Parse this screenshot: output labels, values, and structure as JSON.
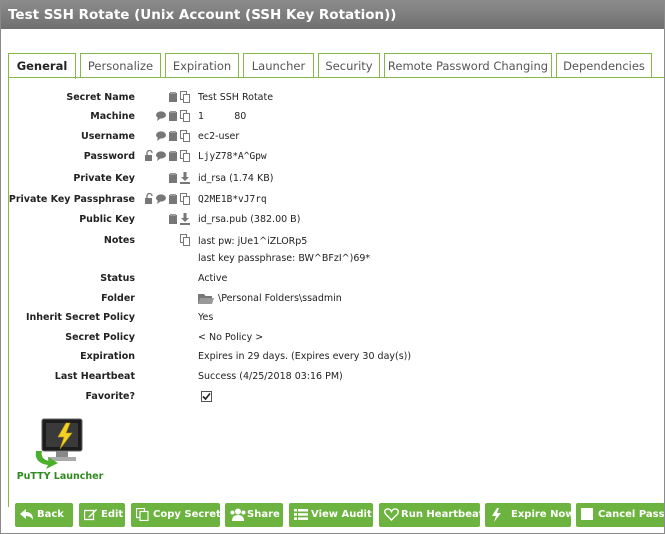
{
  "window": {
    "title": "Test SSH Rotate (Unix Account (SSH Key Rotation))"
  },
  "tabs": [
    {
      "label": "General",
      "active": true
    },
    {
      "label": "Personalize",
      "active": false
    },
    {
      "label": "Expiration",
      "active": false
    },
    {
      "label": "Launcher",
      "active": false
    },
    {
      "label": "Security",
      "active": false
    },
    {
      "label": "Remote Password Changing",
      "active": false
    },
    {
      "label": "Dependencies",
      "active": false
    }
  ],
  "fields": {
    "secret_name": {
      "label": "Secret Name",
      "value": "Test SSH Rotate"
    },
    "machine": {
      "label": "Machine",
      "value": "1          80"
    },
    "username": {
      "label": "Username",
      "value": "ec2-user"
    },
    "password": {
      "label": "Password",
      "value": "LjyZ78*A^Gpw"
    },
    "private_key": {
      "label": "Private Key",
      "value": "id_rsa (1.74 KB)"
    },
    "private_key_passphrase": {
      "label": "Private Key Passphrase",
      "value": "Q2ME1B*vJ7rq"
    },
    "public_key": {
      "label": "Public Key",
      "value": "id_rsa.pub (382.00 B)"
    },
    "notes": {
      "label": "Notes",
      "line1": "last pw: jUe1^iZLORp5",
      "line2": "last key passphrase: BW^BFzI^)69*"
    },
    "status": {
      "label": "Status",
      "value": "Active"
    },
    "folder": {
      "label": "Folder",
      "value": "\\Personal Folders\\ssadmin"
    },
    "inherit_secret_policy": {
      "label": "Inherit Secret Policy",
      "value": "Yes"
    },
    "secret_policy": {
      "label": "Secret Policy",
      "value": "< No Policy >"
    },
    "expiration": {
      "label": "Expiration",
      "value": "Expires in 29 days. (Expires every 30 day(s))"
    },
    "last_heartbeat": {
      "label": "Last Heartbeat",
      "value": "Success (4/25/2018 03:16 PM)"
    },
    "favorite": {
      "label": "Favorite?",
      "checked": true
    }
  },
  "launcher": {
    "label": "PuTTY Launcher"
  },
  "buttons": {
    "back": "Back",
    "edit": "Edit",
    "copy_secret": "Copy Secret",
    "share": "Share",
    "view_audit": "View Audit",
    "run_heartbeat": "Run Heartbeat",
    "expire_now": "Expire Now",
    "cancel_password": "Cancel Passw"
  },
  "colors": {
    "accent": "#6cb33f",
    "title_bar": "#7d7d7d",
    "tab_border": "#86b84a"
  }
}
